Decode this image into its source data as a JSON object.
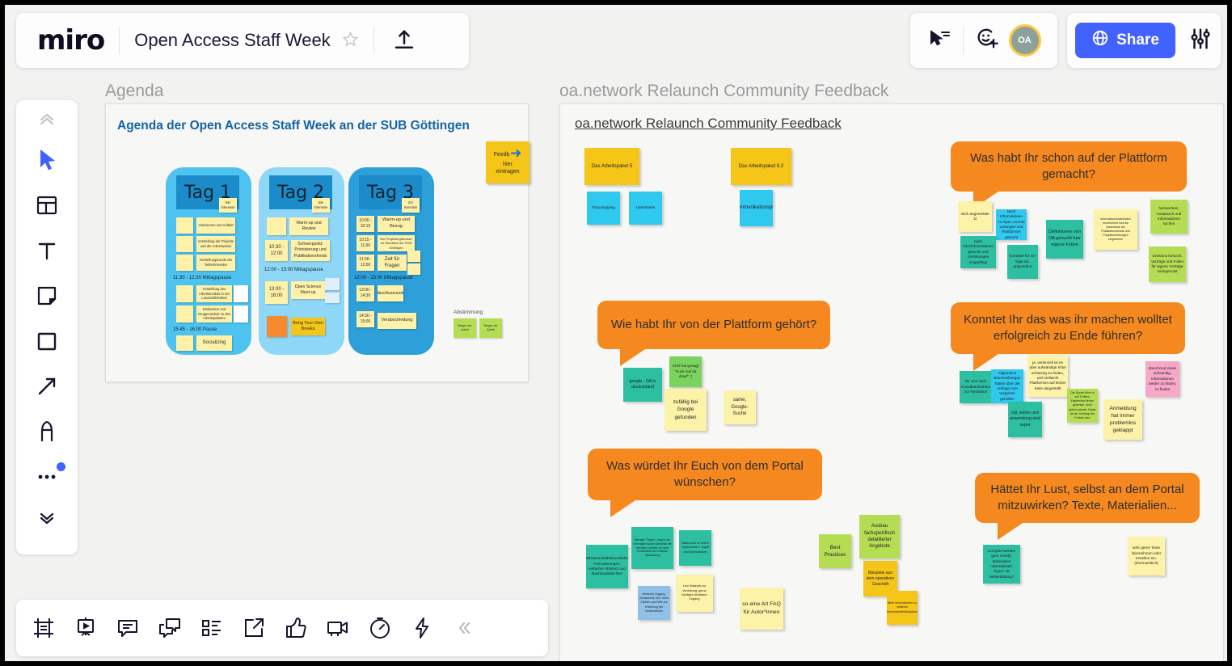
{
  "window": {
    "border_color": "#000000",
    "canvas_bg": "#f2f2f1"
  },
  "header": {
    "logo": "miro",
    "board_title": "Open Access Staff Week",
    "star_icon": "star-icon",
    "upload_icon": "upload-icon",
    "cursor_icon": "cursor-share-icon",
    "invite_icon": "invite-member-icon",
    "avatar_initials": "OA",
    "share_label": "Share",
    "globe_icon": "globe-icon",
    "settings_icon": "sliders-icon",
    "share_color": "#4262ff",
    "avatar_ring_color": "#ffc83d"
  },
  "left_toolbar": {
    "items": [
      {
        "name": "collapse-up-icon",
        "label": "Collapse"
      },
      {
        "name": "cursor-select-icon",
        "label": "Select"
      },
      {
        "name": "templates-icon",
        "label": "Templates"
      },
      {
        "name": "text-icon",
        "label": "Text"
      },
      {
        "name": "sticky-note-icon",
        "label": "Sticky note"
      },
      {
        "name": "shape-icon",
        "label": "Shape"
      },
      {
        "name": "arrow-icon",
        "label": "Connection line"
      },
      {
        "name": "pen-icon",
        "label": "Pen"
      },
      {
        "name": "more-tools-icon",
        "label": "More tools"
      },
      {
        "name": "expand-down-icon",
        "label": "More"
      }
    ]
  },
  "bottom_toolbar": {
    "items": [
      {
        "name": "frame-icon",
        "label": "Frames"
      },
      {
        "name": "presentation-icon",
        "label": "Presentation mode"
      },
      {
        "name": "comment-icon",
        "label": "Comments"
      },
      {
        "name": "chat-icon",
        "label": "Chat"
      },
      {
        "name": "cards-icon",
        "label": "Cards"
      },
      {
        "name": "export-icon",
        "label": "Export"
      },
      {
        "name": "thumbs-up-icon",
        "label": "Reactions"
      },
      {
        "name": "video-icon",
        "label": "Video chat"
      },
      {
        "name": "timer-icon",
        "label": "Timer"
      },
      {
        "name": "lightning-icon",
        "label": "Apps"
      },
      {
        "name": "collapse-left-icon",
        "label": "Collapse"
      }
    ]
  },
  "canvas": {
    "frames": [
      {
        "label": "Agenda"
      },
      {
        "label": "oa.network Relaunch Community Feedback"
      }
    ],
    "agenda": {
      "title": "Agenda der Open Access Staff Week an der SUB Göttingen",
      "feedback_note": {
        "line1": "Feedb",
        "line2": "hier",
        "line3": "eintragen",
        "arrow_icon": "arrow-right-icon",
        "color": "#f5c518"
      },
      "abstimmung_label": "Abstimmung",
      "abstimmung_notes": [
        "Wegen der Arbeit",
        "Wegen der Arbeit"
      ],
      "days": [
        {
          "title": "Tag 1",
          "color": "#4ec3f0",
          "head_note": "Bei Interesse",
          "items": [
            {
              "time": "",
              "text": "Ankommen und Auftakt"
            },
            {
              "time": "",
              "text": "Vorstellung der Projekte und der Arbeitsweise"
            },
            {
              "time": "",
              "text": "Vorstellungsrunde der Teilnehmenden"
            }
          ],
          "breaks": [
            "11:30 - 12:30 Mittagspause",
            "15:45 - 16:00 Pause"
          ],
          "items2": [
            {
              "time": "",
              "text": "Vorstellung des Arbeitsmoduls in der Landesbibliothek"
            },
            {
              "time": "",
              "text": "Diskussion und Gruppenarbeit zu den Arbeitspaketen"
            }
          ],
          "last": "Socializing"
        },
        {
          "title": "Tag 2",
          "color": "#8fd7f7",
          "head_note": "Bei Interesse",
          "items": [
            {
              "time": "",
              "text": "Warm-up und Review"
            },
            {
              "time": "10:30 - 12:00",
              "text": "Schwerpunkt: Priorisierung und Publikationsfonds"
            }
          ],
          "breaks": [
            "12:00 - 13:00 Mittagspause"
          ],
          "items2": [
            {
              "time": "13:00 - 16:00",
              "text": "Open Science Meet-up"
            }
          ],
          "last": "Bring Your Own Breaks"
        },
        {
          "title": "Tag 3",
          "color": "#2d9fd9",
          "head_note": "Zur Kenntnis",
          "items": [
            {
              "time": "10:00 - 10:15",
              "text": "Warm-up und Bezug"
            },
            {
              "time": "10:15 - 11:00",
              "text": "Die Projektergebnisse im Überblick der SUB Göttingen"
            },
            {
              "time": "11:00 - 12:00",
              "text": "Zeit für Fragen"
            }
          ],
          "breaks": [
            "12:00 - 13:00 Mittagspause"
          ],
          "items2": [
            {
              "time": "13:00 - 14:30",
              "text": "Abschlussrunde"
            },
            {
              "time": "14:30 - 15:00",
              "text": "Verabschiedung"
            }
          ],
          "last": ""
        }
      ]
    },
    "feedback_board": {
      "title": "oa.network Relaunch Community Feedback",
      "work_packages": [
        {
          "text": "Das Arbeitspaket 5",
          "color": "#f5c518"
        },
        {
          "text": "Das Arbeitspaket 6.2",
          "color": "#f5c518"
        }
      ],
      "sub_notes": [
        {
          "text": "Tracymapping",
          "color": "#2fc8ee"
        },
        {
          "text": "Userstories",
          "color": "#2fc8ee"
        },
        {
          "text": "Kommunikationsplan",
          "color": "#2fc8ee"
        }
      ],
      "questions": [
        {
          "text": "Was habt Ihr schon auf der Plattform gemacht?",
          "notes": [
            {
              "text": "mich angemeldet :D",
              "color": "#fdf3a8"
            },
            {
              "text": "Nach Informationen zu Open Access Lösungen und Plattformen gesucht",
              "color": "#2fc8ee"
            },
            {
              "text": "nach Fachinformationen gesucht und Verlinkungen eingepflegt",
              "color": "#2cbfa2"
            },
            {
              "text": "Kontakte für OA Tage etc. angesehen",
              "color": "#2cbfa2"
            },
            {
              "text": "Definitionen von OA gesucht fuer eigene Folien",
              "color": "#2cbfa2"
            },
            {
              "text": "Informationsmaterialien recherchiert und die Datenbank der Publikationsfonds und Projektverlinkungen eingesehen",
              "color": "#fdf3a8"
            },
            {
              "text": "Netzwerken, Austausch und Informationen suchen",
              "color": "#b5dd53"
            },
            {
              "text": "Sessions besucht, Vorträge und Folien für eigene Vorträge nachgenutzt",
              "color": "#b5dd53"
            }
          ]
        },
        {
          "text": "Wie habt Ihr von der Plattform gehört?",
          "notes": [
            {
              "text": "google - OA in deutschland",
              "color": "#2cbfa2"
            },
            {
              "text": "Chef hat gesagt \"Kuck mal da drauf\" :)",
              "color": "#7ad35c"
            },
            {
              "text": "zufällig bei Google gefunden",
              "color": "#fdf3a8"
            },
            {
              "text": "same, Google-Suche",
              "color": "#fdf3a8"
            }
          ]
        },
        {
          "text": "Konntet Ihr das was ihr machen wolltet erfolgreich zu Ende führen?",
          "notes": [
            {
              "text": "tlw. erst nach Kontaktaufnahme zur Redaktion",
              "color": "#2cbfa2"
            },
            {
              "text": "Allgemeine Beschreibungen hätten über die Anfrage zum Vorgehen geholfen",
              "color": "#2fc8ee"
            },
            {
              "text": "ja, vereinzelt ist es aber aufwändige Infos schwierig zu finden, weil vielleicht Plattformen auf keiner Seite dargestellt",
              "color": "#fdf3a8"
            },
            {
              "text": "Die Suche führt zu viel Treffern, Ergebnisse finden gewesen, nicht gleich schnell. Dabei ist der Umfang des Portals sehr",
              "color": "#b5dd53"
            },
            {
              "text": "toll, seiten und anwendung sind super",
              "color": "#2cbfa2"
            },
            {
              "text": "Anmeldung hat immer problemlos geklappt",
              "color": "#fdf3a8"
            },
            {
              "text": "Manchmal etwas aufwändig, Informationen wieder zu finden, zu finden",
              "color": "#f7a8c8"
            }
          ]
        },
        {
          "text": "Was würdet Ihr Euch von dem Portal wünschen?",
          "notes": [
            {
              "text": "Wissenschaftsfreundliche Formulierungen, einfacher Abstract und downloadable flyer",
              "color": "#2cbfa2"
            },
            {
              "text": "Weniger \"Gegen\"-Jargon, ein sehr klarer kurzer Überblick mit verlinkter Literatur für mehr Verständnis und einfache Anwendung",
              "color": "#2cbfa2"
            },
            {
              "text": "Basis-Infos zu einem \"strukturierten\" Zugriff und Informationen",
              "color": "#2cbfa2"
            },
            {
              "text": "einfacher Zugang, Zusatzinfos, inkl. mehr Suchen und Hilfe zur Erstellung gut verwendbarer",
              "color": "#8fc0e8"
            },
            {
              "text": "Lern Material zur Verlinkung, gerne häufiger sichtbarer Zugang",
              "color": "#fdf3a8"
            },
            {
              "text": "so eine Art FAQ für Autor*innen",
              "color": "#fdf3a8"
            },
            {
              "text": "Best Practices",
              "color": "#b5dd53"
            },
            {
              "text": "Ausbau fachspezifisch detaillierter Angebote",
              "color": "#b5dd53"
            },
            {
              "text": "Beispiele aus dem operativen Geschäft",
              "color": "#f5c518"
            },
            {
              "text": "Mehr Informationen zu weiteren Wissenschaftsdisziplinen",
              "color": "#f5c518"
            }
          ]
        },
        {
          "text": "Hättet Ihr Lust, selbst an dem Portal mitzuwirken? Texte, Materialien...",
          "notes": [
            {
              "text": "Lernpfad werden gern erstellt, Materialien mitentwickelt, Tipps? als Weiterbildung?",
              "color": "#2cbfa2"
            },
            {
              "text": "sehr gerne Texte übernehmen oder erstellen etc. (ehrenamtlich)",
              "color": "#fdf3a8"
            }
          ]
        }
      ]
    }
  }
}
